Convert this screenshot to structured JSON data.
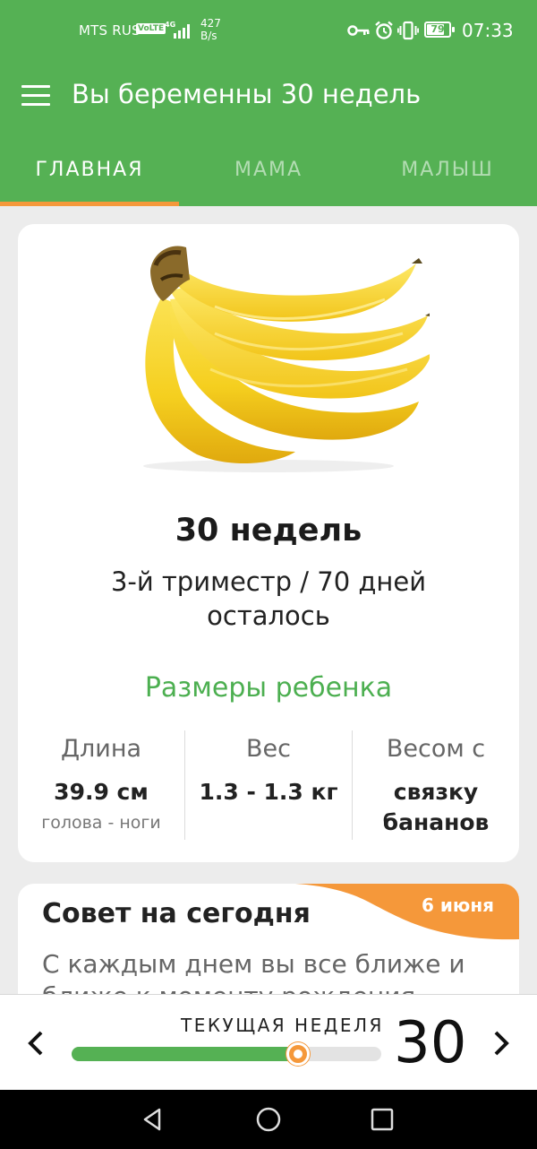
{
  "status_bar": {
    "carrier": "MTS RUS",
    "volte": "VoLTE",
    "network": "4G",
    "speed_value": "427",
    "speed_unit": "B/s",
    "battery": "79",
    "battery_level": 0.79,
    "time": "07:33",
    "icons": [
      "key-icon",
      "alarm-icon",
      "vibrate-icon",
      "battery-icon"
    ]
  },
  "app_bar": {
    "title": "Вы беременны 30 недель",
    "menu_icon": "menu-icon"
  },
  "tabs": [
    {
      "label": "ГЛАВНАЯ",
      "active": true
    },
    {
      "label": "МАМА",
      "active": false
    },
    {
      "label": "МАЛЫШ",
      "active": false
    }
  ],
  "main_card": {
    "image": "bananas",
    "week_title": "30 недель",
    "trimester_text": "3-й триместр / 70 дней осталось",
    "sizes_title": "Размеры ребенка",
    "stats": [
      {
        "label": "Длина",
        "value": "39.9 см",
        "note": "голова - ноги"
      },
      {
        "label": "Вес",
        "value": "1.3 - 1.3 кг",
        "note": ""
      },
      {
        "label": "Весом с",
        "value": "связку бананов",
        "note": ""
      }
    ]
  },
  "tip_card": {
    "title": "Совет на сегодня",
    "date": "6 июня",
    "text": "С каждым днем вы все ближе и ближе к моменту рождения"
  },
  "week_selector": {
    "label": "ТЕКУЩАЯ НЕДЕЛЯ",
    "week": "30",
    "progress": 0.73,
    "prev_icon": "chevron-left-icon",
    "next_icon": "chevron-right-icon"
  },
  "colors": {
    "primary": "#55b154",
    "accent": "#f5983a",
    "text_green": "#4caf50"
  }
}
